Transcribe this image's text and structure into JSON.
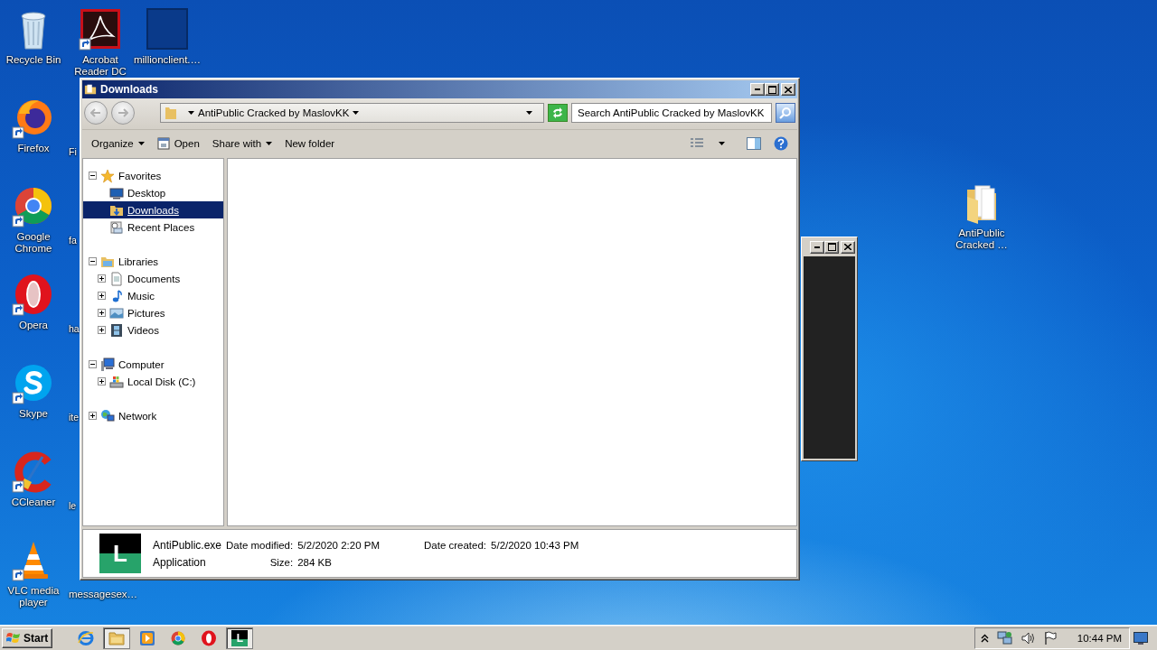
{
  "desktop": {
    "columns": [
      [
        {
          "label": "Recycle Bin",
          "kind": "recycle",
          "shortcut": false
        },
        {
          "label": "Firefox",
          "kind": "firefox",
          "shortcut": true
        },
        {
          "label": "Google\nChrome",
          "kind": "chrome",
          "shortcut": true
        },
        {
          "label": "Opera",
          "kind": "opera",
          "shortcut": true
        },
        {
          "label": "Skype",
          "kind": "skype",
          "shortcut": true
        },
        {
          "label": "CCleaner",
          "kind": "ccleaner",
          "shortcut": true
        },
        {
          "label": "VLC media\nplayer",
          "kind": "vlc",
          "shortcut": true
        }
      ],
      [
        {
          "label": "Acrobat\nReader DC",
          "kind": "acrobat",
          "shortcut": true
        },
        {
          "label": "Fi",
          "kind": "covered"
        },
        {
          "label": "fa",
          "kind": "covered"
        },
        {
          "label": "ha",
          "kind": "covered"
        },
        {
          "label": "ite",
          "kind": "covered"
        },
        {
          "label": "le",
          "kind": "covered"
        },
        {
          "label": "messagesex…",
          "kind": "covered"
        }
      ],
      [
        {
          "label": "millionclient.…",
          "kind": "blank",
          "shortcut": false
        }
      ]
    ],
    "right_icons": [
      {
        "label": "AntiPublic\nCracked …",
        "kind": "folder",
        "shortcut": false
      }
    ]
  },
  "explorer": {
    "title": "Downloads",
    "active": true,
    "address": "AntiPublic Cracked by MaslovKK",
    "search": {
      "placeholder": "Search AntiPublic Cracked by MaslovKK"
    },
    "commands": [
      {
        "label": "Organize",
        "kind": "menu"
      },
      {
        "label": "Open",
        "kind": "open"
      },
      {
        "label": "Share with",
        "kind": "menu"
      },
      {
        "label": "New folder",
        "kind": "plain"
      }
    ],
    "nav": [
      {
        "label": "Favorites",
        "kind": "star",
        "expanded": true,
        "selected": false,
        "children": [
          {
            "label": "Desktop",
            "kind": "desktop",
            "selected": false
          },
          {
            "label": "Downloads",
            "kind": "downloads",
            "selected": true
          },
          {
            "label": "Recent Places",
            "kind": "recent",
            "selected": false
          }
        ]
      },
      {
        "label": "Libraries",
        "kind": "library",
        "expanded": true,
        "selected": false,
        "children": [
          {
            "label": "Documents",
            "kind": "document",
            "expanded": false,
            "selected": false
          },
          {
            "label": "Music",
            "kind": "music",
            "expanded": false,
            "selected": false
          },
          {
            "label": "Pictures",
            "kind": "pictures",
            "expanded": false,
            "selected": false
          },
          {
            "label": "Videos",
            "kind": "videos",
            "expanded": false,
            "selected": false
          }
        ]
      },
      {
        "label": "Computer",
        "kind": "computer",
        "expanded": true,
        "selected": false,
        "children": [
          {
            "label": "Local Disk (C:)",
            "kind": "disk",
            "expanded": false,
            "selected": false
          }
        ]
      },
      {
        "label": "Network",
        "kind": "network",
        "expanded": false,
        "selected": false
      }
    ],
    "details": {
      "icon_letter": "L",
      "lines": [
        {
          "primary": "AntiPublic.exe",
          "fields": [
            {
              "label": "Date modified:",
              "value": "5/2/2020 2:20 PM"
            },
            {
              "label": "Date created:",
              "value": "5/2/2020 10:43 PM"
            }
          ]
        },
        {
          "primary": "Application",
          "fields": [
            {
              "label": "Size:",
              "value": "284 KB"
            }
          ]
        }
      ]
    }
  },
  "console": {
    "active": false
  },
  "taskbar": {
    "start": "Start",
    "apps": [
      {
        "kind": "ie",
        "active": false
      },
      {
        "kind": "folder",
        "active": true
      },
      {
        "kind": "media",
        "active": false
      },
      {
        "kind": "chrome",
        "active": false
      },
      {
        "kind": "opera",
        "active": false
      },
      {
        "kind": "letter",
        "letter": "L",
        "active": true
      }
    ],
    "clock": "10:44 PM"
  }
}
